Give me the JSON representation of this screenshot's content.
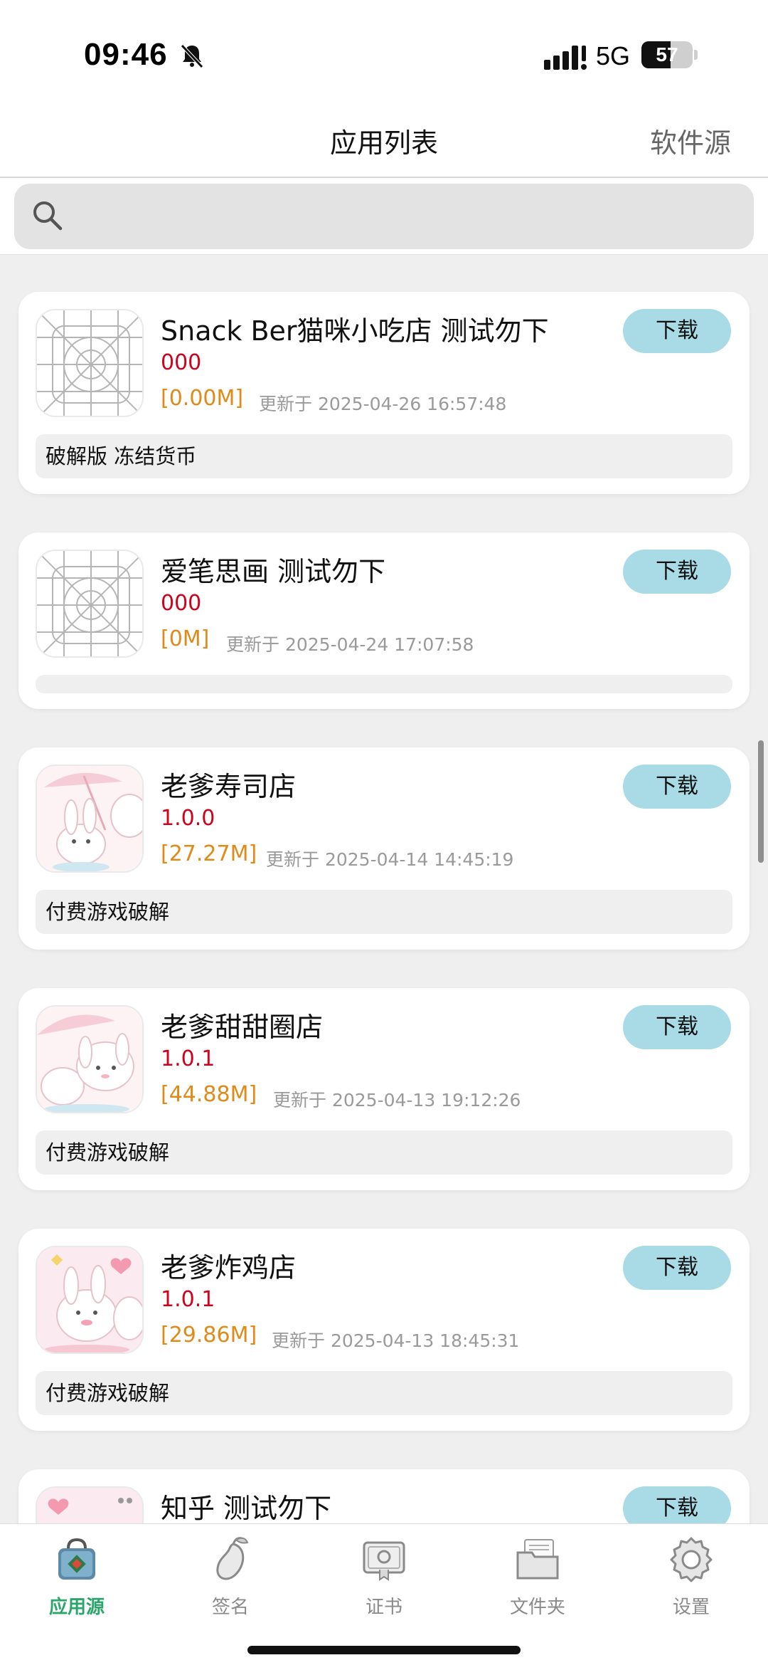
{
  "status": {
    "time": "09:46",
    "network": "5G",
    "battery": "57",
    "battery_level": 0.57
  },
  "nav": {
    "title": "应用列表",
    "right": "软件源"
  },
  "search": {
    "placeholder": ""
  },
  "apps": [
    {
      "name": "Snack Ber猫咪小吃店 测试勿下",
      "version": "000",
      "size": "[0.00M]",
      "updated": "更新于 2025-04-26 16:57:48",
      "desc": "破解版 冻结货币",
      "icon": "placeholder-grid-icon",
      "download": "下载"
    },
    {
      "name": "爱笔思画 测试勿下",
      "version": "000",
      "size": "[0M]",
      "updated": "更新于 2025-04-24 17:07:58",
      "desc": "",
      "icon": "placeholder-grid-icon",
      "download": "下载"
    },
    {
      "name": "老爹寿司店",
      "version": "1.0.0",
      "size": "[27.27M]",
      "updated": "更新于 2025-04-14 14:45:19",
      "desc": "付费游戏破解",
      "icon": "bunny-umbrella-icon",
      "download": "下载"
    },
    {
      "name": "老爹甜甜圈店",
      "version": "1.0.1",
      "size": "[44.88M]",
      "updated": "更新于 2025-04-13 19:12:26",
      "desc": "付费游戏破解",
      "icon": "bunny-umbrella-icon",
      "download": "下载"
    },
    {
      "name": "老爹炸鸡店",
      "version": "1.0.1",
      "size": "[29.86M]",
      "updated": "更新于 2025-04-13 18:45:31",
      "desc": "付费游戏破解",
      "icon": "bunny-hearts-icon",
      "download": "下载"
    },
    {
      "name": "知乎 测试勿下",
      "version": "",
      "size": "",
      "updated": "",
      "desc": "",
      "icon": "bunny-hearts-icon",
      "download": "下载"
    }
  ],
  "tabs": [
    {
      "label": "应用源",
      "icon": "app-source-bag-icon",
      "active": true
    },
    {
      "label": "签名",
      "icon": "signature-mango-icon",
      "active": false
    },
    {
      "label": "证书",
      "icon": "certificate-icon",
      "active": false
    },
    {
      "label": "文件夹",
      "icon": "folder-icon",
      "active": false
    },
    {
      "label": "设置",
      "icon": "settings-gear-icon",
      "active": false
    }
  ],
  "colors": {
    "accent": "#2aa66a",
    "download_bg": "#a8dbe6",
    "version": "#d0021b",
    "size": "#e08a1a"
  }
}
